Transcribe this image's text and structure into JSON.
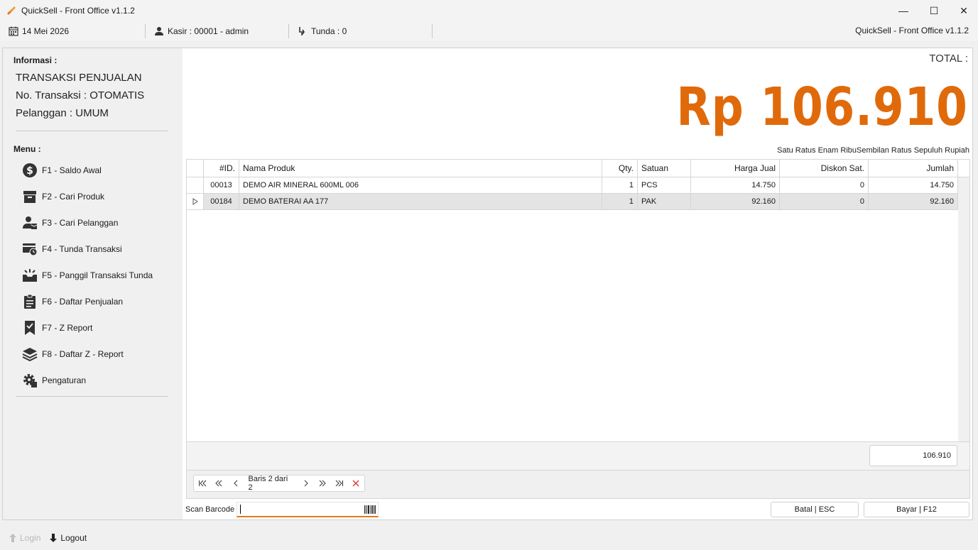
{
  "window": {
    "title": "QuickSell - Front Office v1.1.2",
    "minimize": "—",
    "maximize": "☐",
    "close": "✕"
  },
  "statusbar": {
    "date": "14 Mei 2026",
    "kasir": "Kasir : 00001 - admin",
    "tunda": "Tunda : 0",
    "app_version": "QuickSell - Front Office v1.1.2"
  },
  "sidebar": {
    "info_label": "Informasi :",
    "transaction_type": "TRANSAKSI PENJUALAN",
    "transaction_no": "No. Transaksi : OTOMATIS",
    "customer": "Pelanggan : UMUM",
    "menu_label": "Menu :",
    "menu": [
      {
        "label": "F1 - Saldo Awal",
        "icon": "dollar-circle-icon"
      },
      {
        "label": "F2 - Cari Produk",
        "icon": "archive-box-icon"
      },
      {
        "label": "F3 - Cari Pelanggan",
        "icon": "user-box-icon"
      },
      {
        "label": "F4 - Tunda Transaksi",
        "icon": "card-clock-icon"
      },
      {
        "label": "F5 - Panggil Transaksi Tunda",
        "icon": "inbox-recall-icon"
      },
      {
        "label": "F6 - Daftar Penjualan",
        "icon": "clipboard-list-icon"
      },
      {
        "label": "F7 - Z Report",
        "icon": "bookmark-check-icon"
      },
      {
        "label": "F8 - Daftar Z - Report",
        "icon": "layers-icon"
      },
      {
        "label": "Pengaturan",
        "icon": "gear-icon"
      }
    ]
  },
  "summary": {
    "total_label": "TOTAL :",
    "total_value": "Rp 106.910",
    "terbilang": "Satu Ratus Enam RibuSembilan Ratus Sepuluh Rupiah"
  },
  "grid": {
    "columns": [
      "#ID.",
      "Nama Produk",
      "Qty.",
      "Satuan",
      "Harga Jual",
      "Diskon Sat.",
      "Jumlah"
    ],
    "rows": [
      {
        "id": "00013",
        "nama": "DEMO AIR MINERAL 600ML 006",
        "qty": "1",
        "satuan": "PCS",
        "harga": "14.750",
        "diskon": "0",
        "jumlah": "14.750",
        "selected": false
      },
      {
        "id": "00184",
        "nama": "DEMO BATERAI AA 177",
        "qty": "1",
        "satuan": "PAK",
        "harga": "92.160",
        "diskon": "0",
        "jumlah": "92.160",
        "selected": true
      }
    ],
    "footer_total": "106.910"
  },
  "navigator": {
    "text": "Baris 2 dari 2"
  },
  "scan": {
    "label": "Scan Barcode",
    "value": ""
  },
  "actions": {
    "batal": "Batal | ESC",
    "bayar": "Bayar | F12"
  },
  "bottombar": {
    "login": "Login",
    "logout": "Logout"
  },
  "colors": {
    "accent": "#e06a0a",
    "selected_row": "#e4e4e4"
  }
}
